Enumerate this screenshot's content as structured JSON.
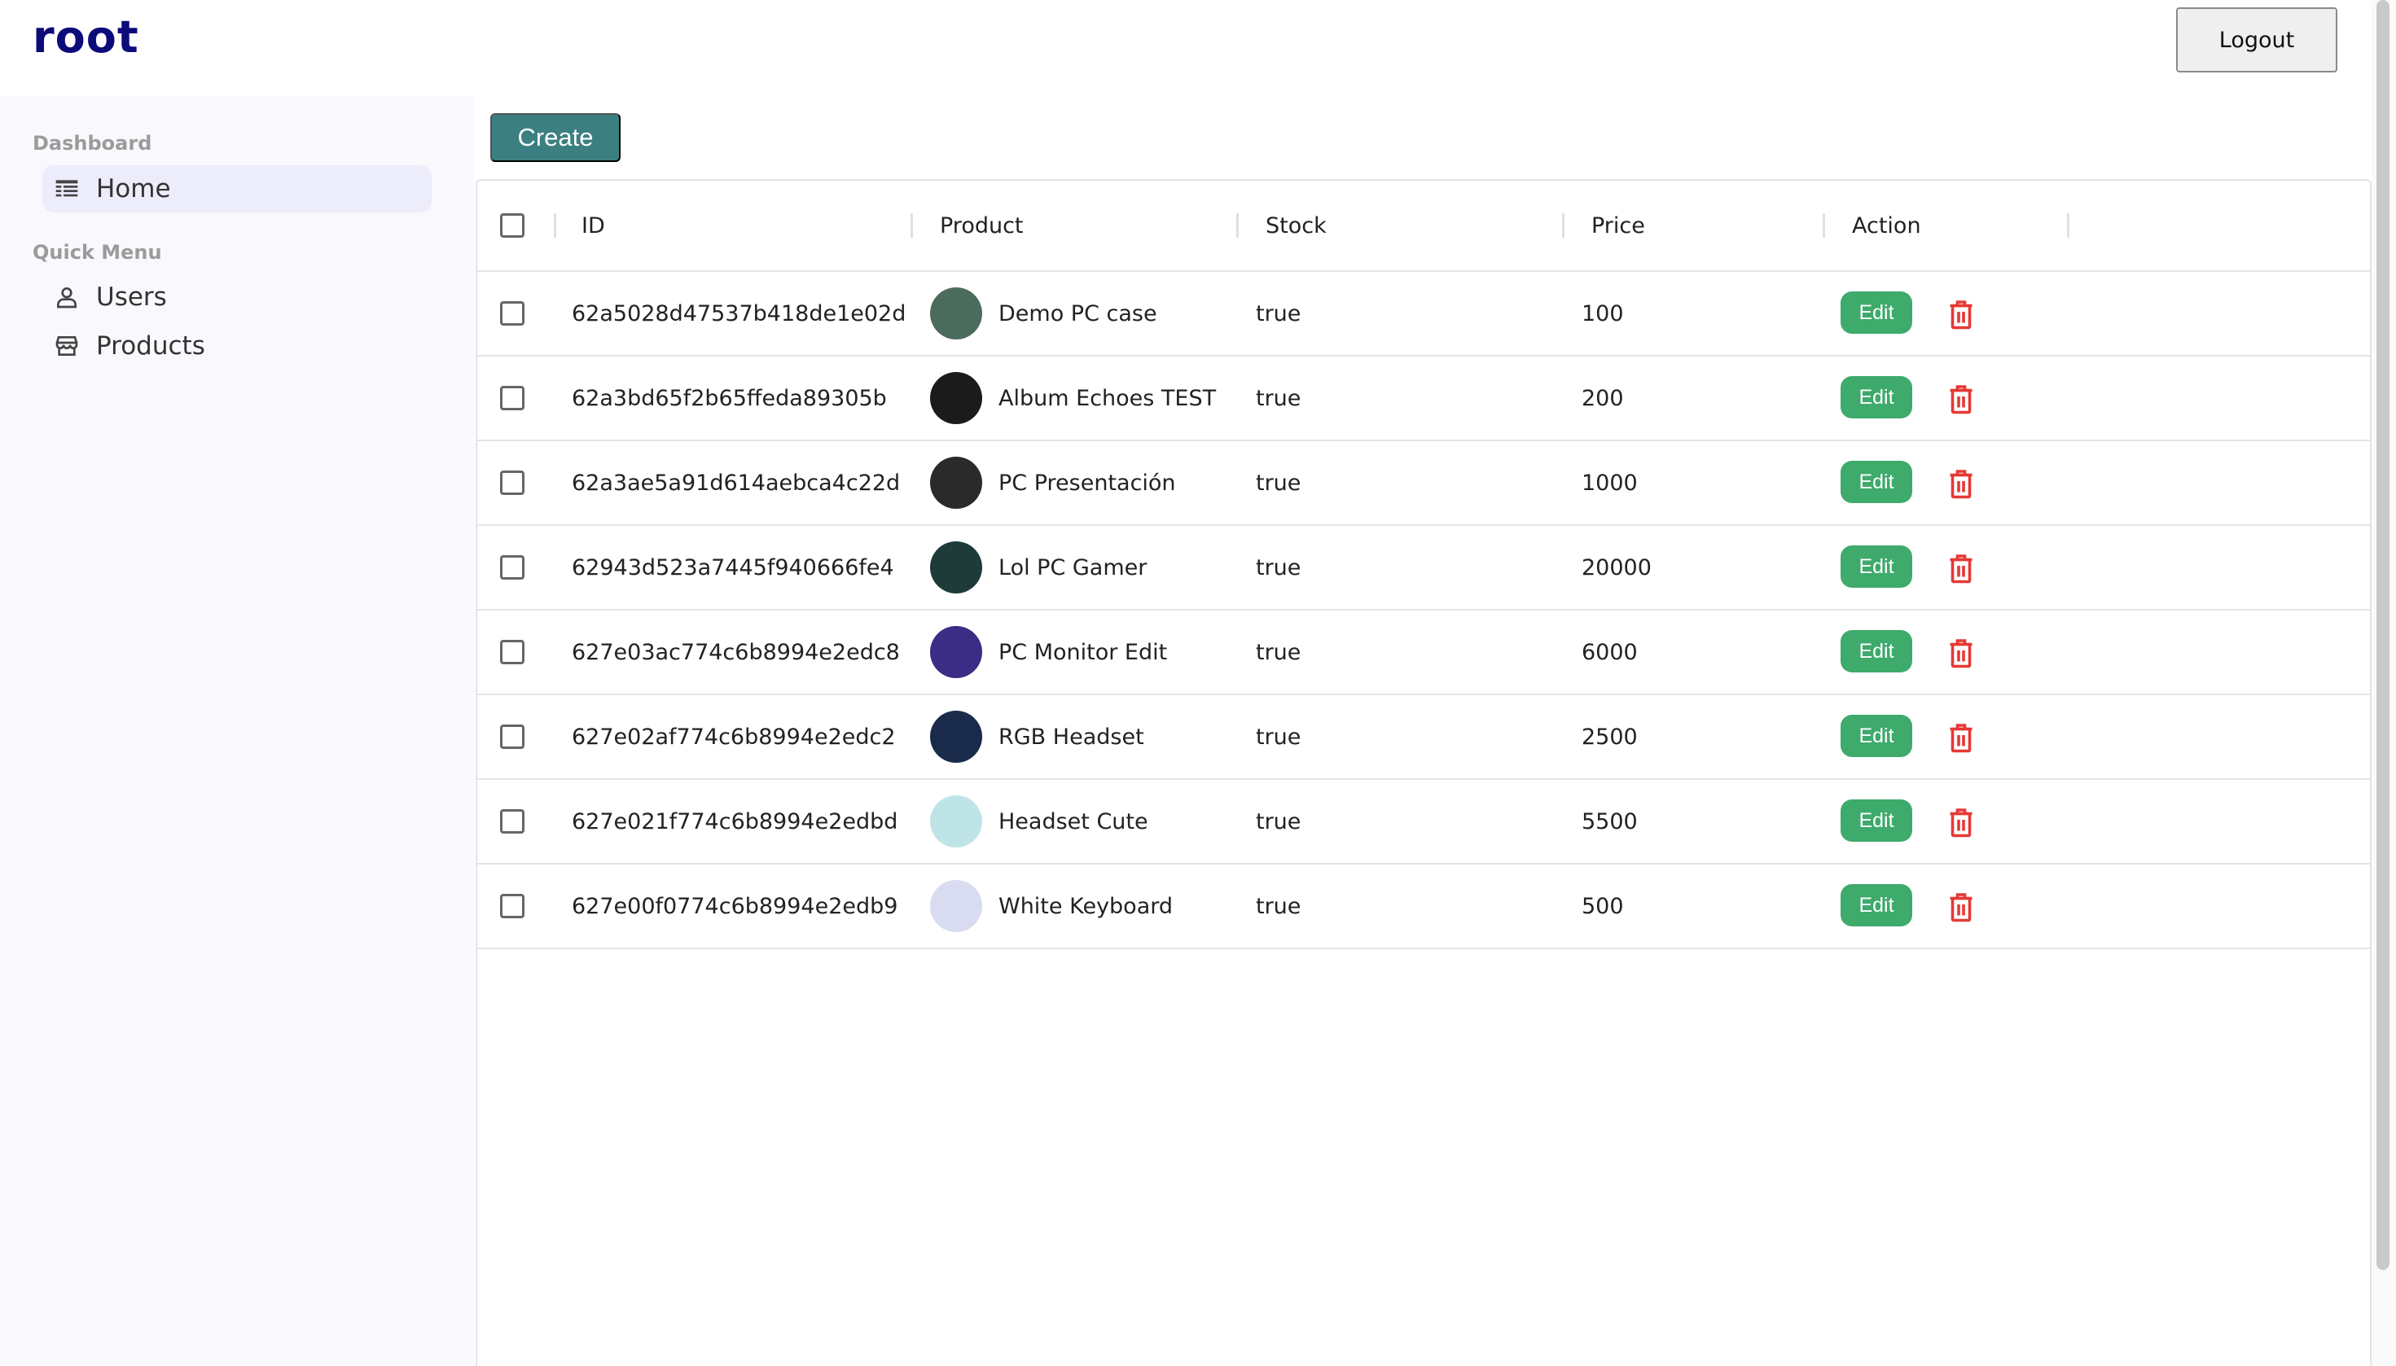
{
  "header": {
    "logo": "root",
    "logout_label": "Logout"
  },
  "sidebar": {
    "sections": [
      {
        "title": "Dashboard",
        "items": [
          {
            "label": "Home",
            "icon": "table-icon",
            "active": true
          }
        ]
      },
      {
        "title": "Quick Menu",
        "items": [
          {
            "label": "Users",
            "icon": "user-icon",
            "active": false
          },
          {
            "label": "Products",
            "icon": "storefront-icon",
            "active": false
          }
        ]
      }
    ]
  },
  "toolbar": {
    "create_label": "Create"
  },
  "table": {
    "columns": [
      "ID",
      "Product",
      "Stock",
      "Price",
      "Action"
    ],
    "edit_label": "Edit",
    "rows": [
      {
        "id": "62a5028d47537b418de1e02d",
        "product": "Demo PC case",
        "stock": "true",
        "price": "100",
        "thumb_color": "#4b6b5c"
      },
      {
        "id": "62a3bd65f2b65ffeda89305b",
        "product": "Album Echoes TEST",
        "stock": "true",
        "price": "200",
        "thumb_color": "#1b1b1b"
      },
      {
        "id": "62a3ae5a91d614aebca4c22d",
        "product": "PC Presentación",
        "stock": "true",
        "price": "1000",
        "thumb_color": "#2a2a2a"
      },
      {
        "id": "62943d523a7445f940666fe4",
        "product": "Lol PC Gamer",
        "stock": "true",
        "price": "20000",
        "thumb_color": "#1e3b3a"
      },
      {
        "id": "627e03ac774c6b8994e2edc8",
        "product": "PC Monitor Edit",
        "stock": "true",
        "price": "6000",
        "thumb_color": "#3b2c86"
      },
      {
        "id": "627e02af774c6b8994e2edc2",
        "product": "RGB Headset",
        "stock": "true",
        "price": "2500",
        "thumb_color": "#1a2a4a"
      },
      {
        "id": "627e021f774c6b8994e2edbd",
        "product": "Headset Cute",
        "stock": "true",
        "price": "5500",
        "thumb_color": "#bfe4e8"
      },
      {
        "id": "627e00f0774c6b8994e2edb9",
        "product": "White Keyboard",
        "stock": "true",
        "price": "500",
        "thumb_color": "#d9dcf0"
      }
    ]
  },
  "colors": {
    "brand": "#0b0b7a",
    "create": "#3c7f80",
    "edit": "#3eaa6c",
    "delete": "#e53935"
  }
}
